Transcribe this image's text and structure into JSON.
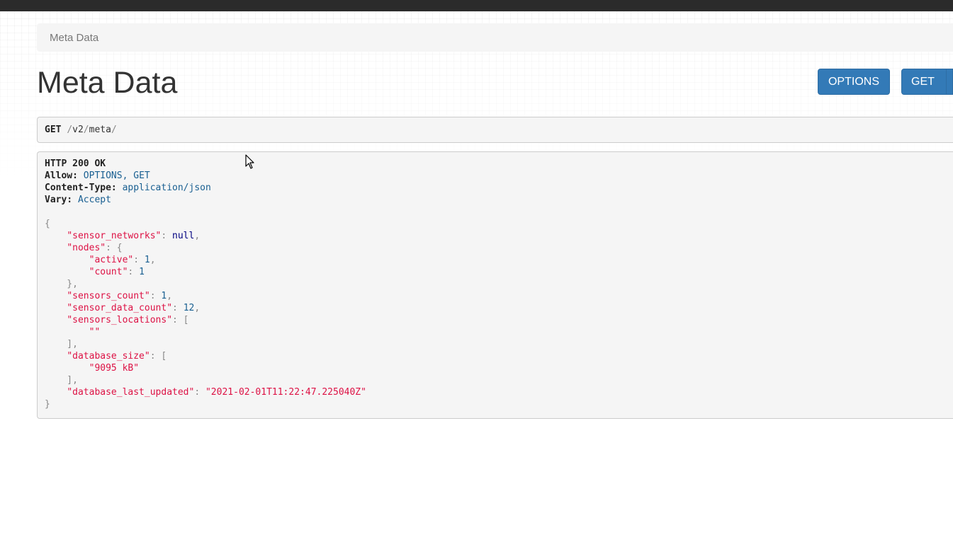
{
  "breadcrumb": {
    "label": "Meta Data"
  },
  "page": {
    "title": "Meta Data"
  },
  "buttons": {
    "options": "OPTIONS",
    "get": "GET"
  },
  "request": {
    "method": "GET",
    "path_seg1": "v2",
    "path_seg2": "meta"
  },
  "response": {
    "status": "HTTP 200 OK",
    "headers": {
      "allow_label": "Allow:",
      "allow_value": "OPTIONS, GET",
      "content_type_label": "Content-Type:",
      "content_type_value": "application/json",
      "vary_label": "Vary:",
      "vary_value": "Accept"
    },
    "body": {
      "sensor_networks_key": "\"sensor_networks\"",
      "sensor_networks_value": "null",
      "nodes_key": "\"nodes\"",
      "active_key": "\"active\"",
      "active_value": "1",
      "count_key": "\"count\"",
      "count_value": "1",
      "sensors_count_key": "\"sensors_count\"",
      "sensors_count_value": "1",
      "sensor_data_count_key": "\"sensor_data_count\"",
      "sensor_data_count_value": "12",
      "sensors_locations_key": "\"sensors_locations\"",
      "sensors_locations_item": "\"\"",
      "database_size_key": "\"database_size\"",
      "database_size_item": "\"9095 kB\"",
      "database_last_updated_key": "\"database_last_updated\"",
      "database_last_updated_value": "\"2021-02-01T11:22:47.225040Z\""
    }
  },
  "colors": {
    "topbar": "#2b2b2b",
    "button": "#337ab7",
    "json_key": "#dd1144",
    "json_number": "#195f91",
    "json_null": "#000080"
  }
}
